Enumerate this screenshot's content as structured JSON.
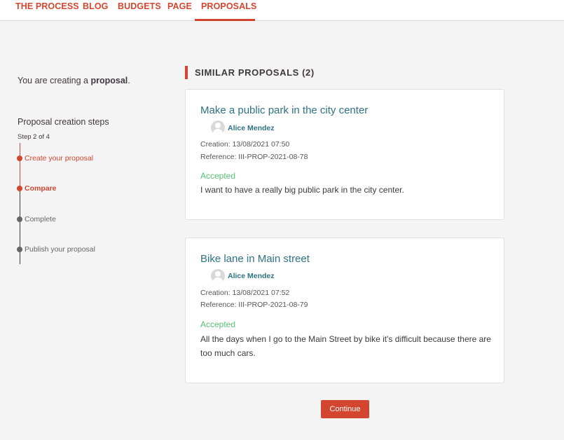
{
  "nav": {
    "items": [
      {
        "label": "THE PROCESS"
      },
      {
        "label": "BLOG"
      },
      {
        "label": "BUDGETS"
      },
      {
        "label": "PAGE"
      },
      {
        "label": "PROPOSALS"
      }
    ]
  },
  "sidebar": {
    "creating_prefix": "You are creating a ",
    "creating_object": "proposal",
    "creating_suffix": ".",
    "steps_title": "Proposal creation steps",
    "steps_count": "Step 2 of 4",
    "steps": [
      {
        "label": "Create your proposal"
      },
      {
        "label": "Compare"
      },
      {
        "label": "Complete"
      },
      {
        "label": "Publish your proposal"
      }
    ]
  },
  "main": {
    "similar_title": "SIMILAR PROPOSALS (2)",
    "proposals": [
      {
        "title": "Make a public park in the city center",
        "author": "Alice Mendez",
        "creation": "Creation: 13/08/2021 07:50",
        "reference": "Reference: III-PROP-2021-08-78",
        "status": "Accepted",
        "summary": "I want to have a really big public park in the city center."
      },
      {
        "title": "Bike lane in Main street",
        "author": "Alice Mendez",
        "creation": "Creation: 13/08/2021 07:52",
        "reference": "Reference: III-PROP-2021-08-79",
        "status": "Accepted",
        "summary": "All the days when I go to the Main Street by bike it's difficult because there are too much cars."
      }
    ],
    "continue_label": "Continue"
  },
  "colors": {
    "accent": "#d4452f",
    "link": "#2f7283",
    "accepted": "#57c373"
  },
  "icons": {
    "avatar": "user-avatar-icon"
  }
}
